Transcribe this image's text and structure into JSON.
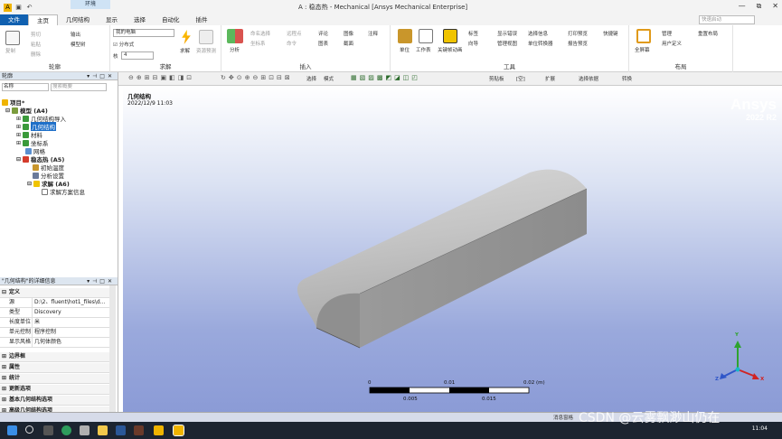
{
  "titlebar": {
    "context_tab": "环境",
    "title": "A : 稳态热 - Mechanical [Ansys Mechanical Enterprise]",
    "controls": [
      "—",
      "⧉",
      "✕"
    ]
  },
  "tabs": [
    "文件",
    "主页",
    "几何结构",
    "显示",
    "选择",
    "自动化",
    "插件"
  ],
  "active_tab": "主页",
  "search_placeholder": "快速启动",
  "ribbon": {
    "groups": [
      "轮廓",
      "求解",
      "插入",
      "工具",
      "布局"
    ],
    "outline": [
      "复制",
      "剪切",
      "粘贴",
      "删除",
      "输出",
      "模型树"
    ],
    "solve": {
      "dropdown": "我的电脑",
      "distributed": "分布式",
      "cores_label": "核",
      "cores": "4",
      "solve": "求解",
      "resource": "资源预测"
    },
    "insert": [
      "分析",
      "命名选择",
      "坐标系",
      "远程点",
      "命令",
      "评论",
      "图表",
      "图像",
      "截面",
      "注释"
    ],
    "tools": [
      "单位",
      "工作表",
      "关键帧动画",
      "标签",
      "向导",
      "显示错误",
      "管理视图",
      "选择信息",
      "单位转换器",
      "打印预览",
      "报告预览",
      "快捷键"
    ],
    "layout": [
      "全屏幕",
      "管理",
      "用户定义",
      "重置布局"
    ]
  },
  "toolbar2": [
    "选择",
    "模式",
    "剪贴板",
    "[空]",
    "扩展",
    "选择依据",
    "转换"
  ],
  "outline_panel": {
    "title": "轮廓",
    "filter_label": "名称",
    "search_placeholder": "搜索概要",
    "tree": [
      {
        "label": "项目*",
        "level": 0
      },
      {
        "label": "模型 (A4)",
        "level": 1
      },
      {
        "label": "几何结构导入",
        "level": 2
      },
      {
        "label": "几何结构",
        "level": 2,
        "selected": true
      },
      {
        "label": "材料",
        "level": 2
      },
      {
        "label": "坐标系",
        "level": 2
      },
      {
        "label": "网格",
        "level": 2
      },
      {
        "label": "稳态热 (A5)",
        "level": 2
      },
      {
        "label": "初始温度",
        "level": 3
      },
      {
        "label": "分析设置",
        "level": 3
      },
      {
        "label": "求解 (A6)",
        "level": 3
      },
      {
        "label": "求解方案信息",
        "level": 4
      }
    ]
  },
  "details_panel": {
    "title": "\"几何结构\"的详细信息",
    "rows": [
      {
        "key": "定义",
        "section": true
      },
      {
        "key": "源",
        "value": "D:\\2、fluent\\hot1_files\\d..."
      },
      {
        "key": "类型",
        "value": "Discovery"
      },
      {
        "key": "长度单位",
        "value": "米"
      },
      {
        "key": "单元控制",
        "value": "程序控制"
      },
      {
        "key": "显示风格",
        "value": "几何体颜色"
      },
      {
        "key": "边界框",
        "section": true
      },
      {
        "key": "属性",
        "section": true
      },
      {
        "key": "统计",
        "section": true
      },
      {
        "key": "更新选项",
        "section": true
      },
      {
        "key": "基本几何结构选项",
        "section": true
      },
      {
        "key": "高级几何结构选项",
        "section": true
      }
    ]
  },
  "viewport": {
    "title": "几何结构",
    "date": "2022/12/9 11:03",
    "logo": "Ansys",
    "version": "2022 R2",
    "scale_labels": [
      "0",
      "0.01",
      "0.02 (m)",
      "0.005",
      "0.015"
    ],
    "triad": [
      "Y",
      "Z",
      "X"
    ]
  },
  "status_bar": {
    "messages": "消息窗格"
  },
  "taskbar": {
    "time": "11:04"
  },
  "watermark": "CSDN @云雾飘渺山仍在"
}
